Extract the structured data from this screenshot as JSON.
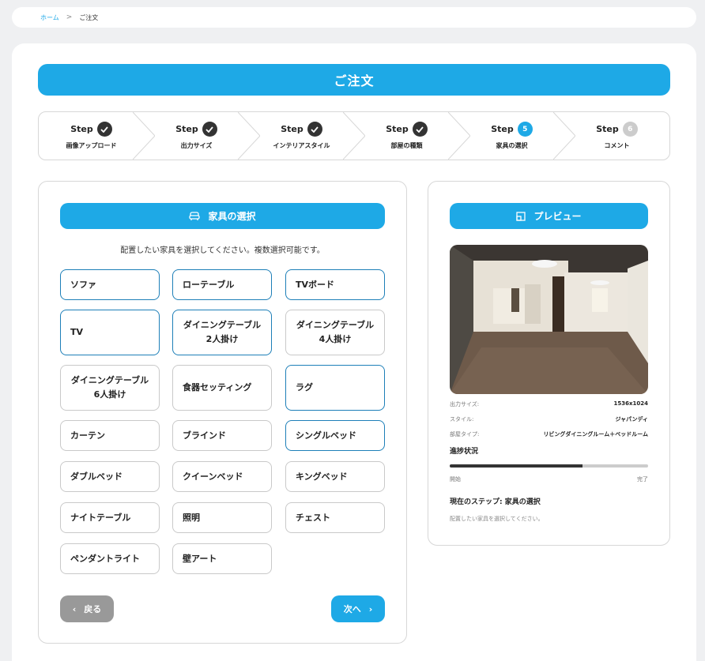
{
  "breadcrumb": {
    "home": "ホーム",
    "sep": ">",
    "current": "ご注文"
  },
  "page_title": "ご注文",
  "steps": [
    {
      "word": "Step",
      "label": "画像アップロード",
      "state": "done",
      "num": ""
    },
    {
      "word": "Step",
      "label": "出力サイズ",
      "state": "done",
      "num": ""
    },
    {
      "word": "Step",
      "label": "インテリアスタイル",
      "state": "done",
      "num": ""
    },
    {
      "word": "Step",
      "label": "部屋の種類",
      "state": "done",
      "num": ""
    },
    {
      "word": "Step",
      "label": "家具の選択",
      "state": "active",
      "num": "5"
    },
    {
      "word": "Step",
      "label": "コメント",
      "state": "pending",
      "num": "6"
    }
  ],
  "furniture": {
    "header": "家具の選択",
    "instruction": "配置したい家具を選択してください。複数選択可能です。",
    "items": [
      {
        "label": "ソファ",
        "selected": true
      },
      {
        "label": "ローテーブル",
        "selected": true
      },
      {
        "label": "TVボード",
        "selected": true
      },
      {
        "label": "TV",
        "selected": true
      },
      {
        "label": "ダイニングテーブル\n2人掛け",
        "selected": true
      },
      {
        "label": "ダイニングテーブル\n4人掛け",
        "selected": false
      },
      {
        "label": "ダイニングテーブル\n6人掛け",
        "selected": false
      },
      {
        "label": "食器セッティング",
        "selected": false
      },
      {
        "label": "ラグ",
        "selected": true
      },
      {
        "label": "カーテン",
        "selected": false
      },
      {
        "label": "ブラインド",
        "selected": false
      },
      {
        "label": "シングルベッド",
        "selected": true
      },
      {
        "label": "ダブルベッド",
        "selected": false
      },
      {
        "label": "クイーンベッド",
        "selected": false
      },
      {
        "label": "キングベッド",
        "selected": false
      },
      {
        "label": "ナイトテーブル",
        "selected": false
      },
      {
        "label": "照明",
        "selected": false
      },
      {
        "label": "チェスト",
        "selected": false
      },
      {
        "label": "ペンダントライト",
        "selected": false
      },
      {
        "label": "壁アート",
        "selected": false
      }
    ],
    "back_label": "戻る",
    "next_label": "次へ"
  },
  "preview": {
    "header": "プレビュー",
    "rows": [
      {
        "key": "出力サイズ:",
        "value": "1536x1024"
      },
      {
        "key": "スタイル:",
        "value": "ジャパンディ"
      },
      {
        "key": "部屋タイプ:",
        "value": "リビングダイニングルーム＋ベッドルーム"
      }
    ],
    "progress_label": "進捗状況",
    "progress": 0.67,
    "start_label": "開始",
    "end_label": "完了",
    "current_step": "現在のステップ: 家具の選択",
    "current_desc": "配置したい家具を選択してください。"
  },
  "colors": {
    "accent": "#1ea9e6",
    "dark": "#333333",
    "border_selected": "#1d7fb8"
  }
}
